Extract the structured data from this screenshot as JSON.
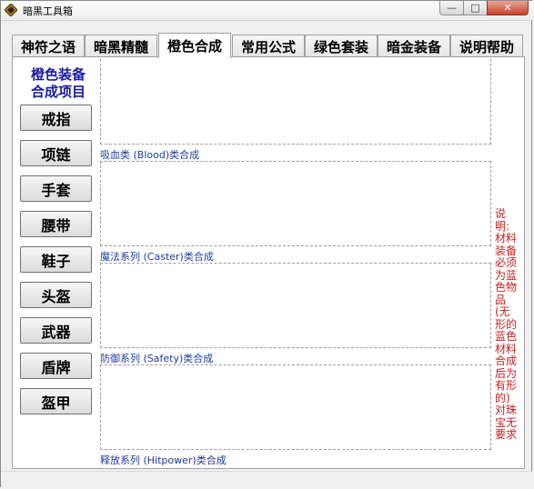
{
  "window": {
    "title": "暗黑工具箱"
  },
  "tabs": [
    {
      "label": "神符之语",
      "active": false
    },
    {
      "label": "暗黑精髓",
      "active": false
    },
    {
      "label": "橙色合成",
      "active": true
    },
    {
      "label": "常用公式",
      "active": false
    },
    {
      "label": "绿色套装",
      "active": false
    },
    {
      "label": "暗金装备",
      "active": false
    },
    {
      "label": "说明帮助",
      "active": false
    }
  ],
  "sidebar": {
    "title_line1": "橙色装备",
    "title_line2": "合成项目",
    "buttons": [
      "戒指",
      "项链",
      "手套",
      "腰带",
      "鞋子",
      "头盔",
      "武器",
      "盾牌",
      "盔甲"
    ]
  },
  "groups": [
    {
      "label": "吸血类 (Blood)类合成"
    },
    {
      "label": "魔法系列 (Caster)类合成"
    },
    {
      "label": "防御系列 (Safety)类合成"
    },
    {
      "label": "释放系列 (Hitpower)类合成"
    }
  ],
  "note": "说明:材料装备必须为蓝色物品(无形的蓝色材料合成后为有形的)对珠宝无要求",
  "colors": {
    "accent": "#1a1aa0",
    "note": "#c82020",
    "group_label": "#1f3aa0"
  }
}
